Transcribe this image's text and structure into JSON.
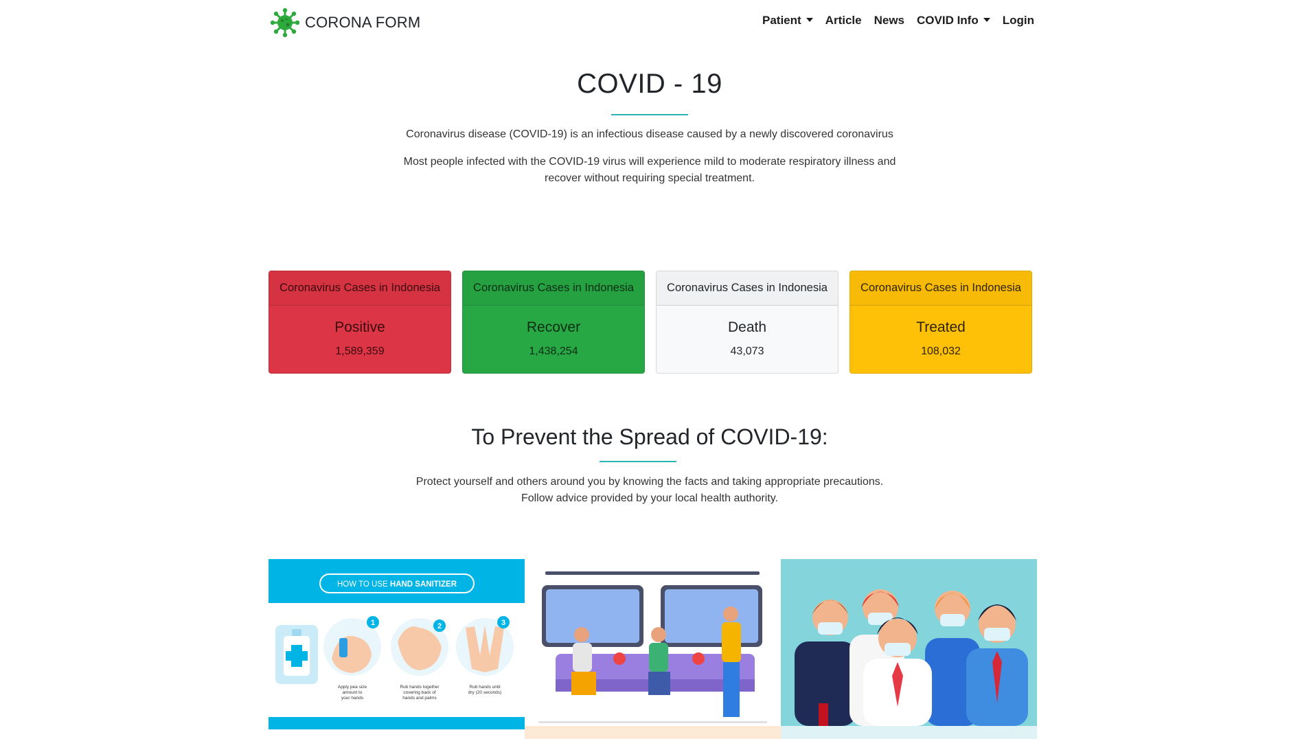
{
  "brand": {
    "name": "CORONA FORM",
    "logo_icon": "virus-icon",
    "logo_color": "#2eaa3c"
  },
  "nav": {
    "items": [
      {
        "label": "Patient",
        "dropdown": true
      },
      {
        "label": "Article",
        "dropdown": false
      },
      {
        "label": "News",
        "dropdown": false
      },
      {
        "label": "COVID Info",
        "dropdown": true
      },
      {
        "label": "Login",
        "dropdown": false
      }
    ]
  },
  "hero": {
    "title": "COVID - 19",
    "paragraph1": "Coronavirus disease (COVID-19) is an infectious disease caused by a newly discovered coronavirus",
    "paragraph2_line1": "Most people infected with the COVID-19 virus will experience mild to moderate respiratory illness and",
    "paragraph2_line2": "recover without requiring special treatment.",
    "accent_color": "#2ab3b8"
  },
  "cards": [
    {
      "header": "Coronavirus Cases in Indonesia",
      "title": "Positive",
      "value": "1,589,359",
      "color": "#dc3545"
    },
    {
      "header": "Coronavirus Cases in Indonesia",
      "title": "Recover",
      "value": "1,438,254",
      "color": "#28a745"
    },
    {
      "header": "Coronavirus Cases in Indonesia",
      "title": "Death",
      "value": "43,073",
      "color": "#f8f9fa"
    },
    {
      "header": "Coronavirus Cases in Indonesia",
      "title": "Treated",
      "value": "108,032",
      "color": "#ffc107"
    }
  ],
  "prevent": {
    "title": "To Prevent the Spread of COVID-19:",
    "line1": "Protect yourself and others around you by knowing the facts and taking appropriate precautions.",
    "line2": "Follow advice provided by your local health authority."
  },
  "images": {
    "sanitizer": {
      "banner": "HOW TO USE",
      "banner_bold": "HAND SANITIZER",
      "steps": [
        {
          "number": "1",
          "caption1": "Apply pea size",
          "caption2": "amount to",
          "caption3": "your hands"
        },
        {
          "number": "2",
          "caption1": "Rub hands together",
          "caption2": "covering back of",
          "caption3": "hands and palms"
        },
        {
          "number": "3",
          "caption1": "Rub hands until",
          "caption2": "dry (20 seconds)",
          "caption3": ""
        }
      ]
    }
  }
}
